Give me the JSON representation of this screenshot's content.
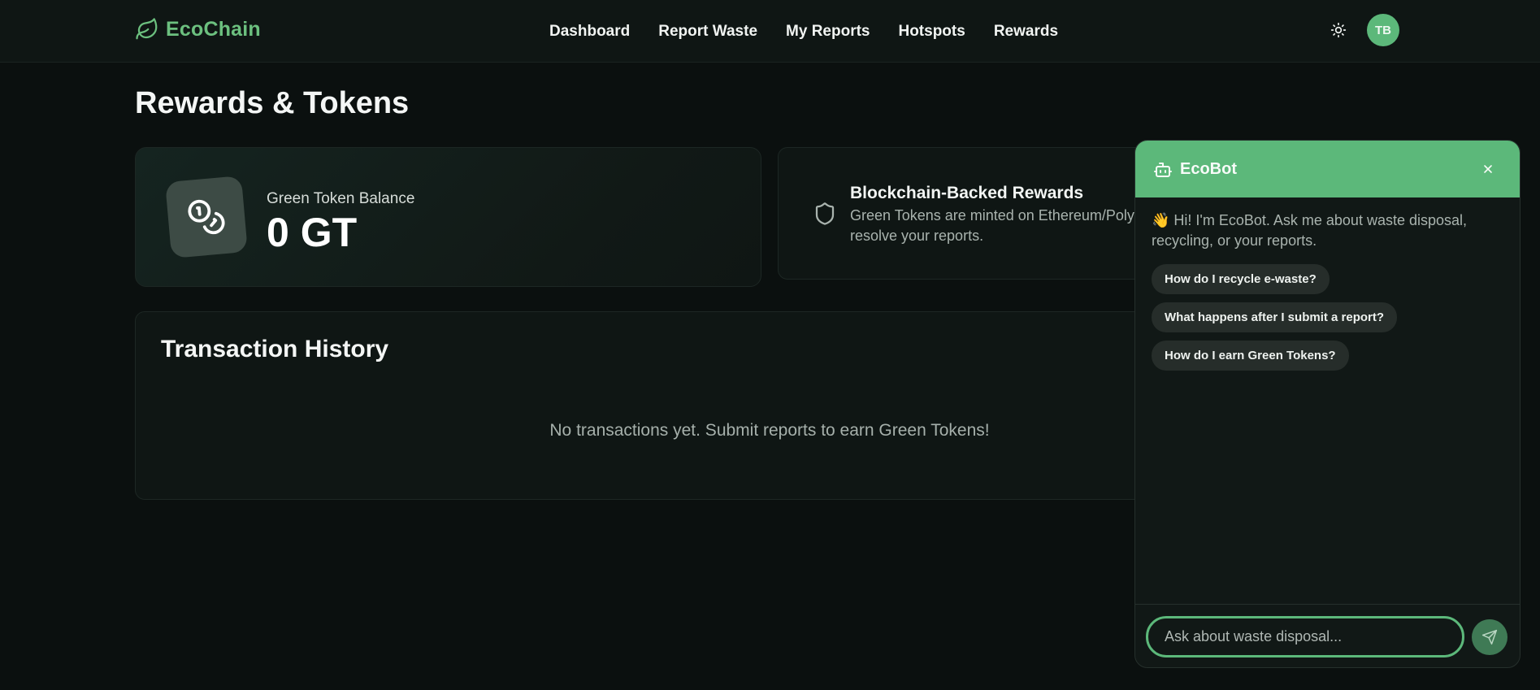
{
  "nav": {
    "brand": "EcoChain",
    "links": [
      "Dashboard",
      "Report Waste",
      "My Reports",
      "Hotspots",
      "Rewards"
    ],
    "avatar_initials": "TB",
    "theme_icon": "sun-icon"
  },
  "page": {
    "title": "Rewards & Tokens"
  },
  "balance": {
    "label": "Green Token Balance",
    "value": "0 GT",
    "icon": "coins-icon"
  },
  "blockchain": {
    "title": "Blockchain-Backed Rewards",
    "text": "Green Tokens are minted on Ethereum/Polygon when authorities resolve your reports.",
    "icon": "shield-icon"
  },
  "transactions": {
    "title": "Transaction History",
    "empty_text": "No transactions yet. Submit reports to earn Green Tokens!"
  },
  "chat": {
    "title": "EcoBot",
    "greeting": "👋 Hi! I'm EcoBot. Ask me about waste disposal, recycling, or your reports.",
    "suggestions": [
      "How do I recycle e-waste?",
      "What happens after I submit a report?",
      "How do I earn Green Tokens?"
    ],
    "input_placeholder": "Ask about waste disposal..."
  },
  "colors": {
    "accent": "#5cb87a",
    "brand_text": "#6cc07f",
    "background": "#0b100f",
    "card": "#0f1614"
  }
}
